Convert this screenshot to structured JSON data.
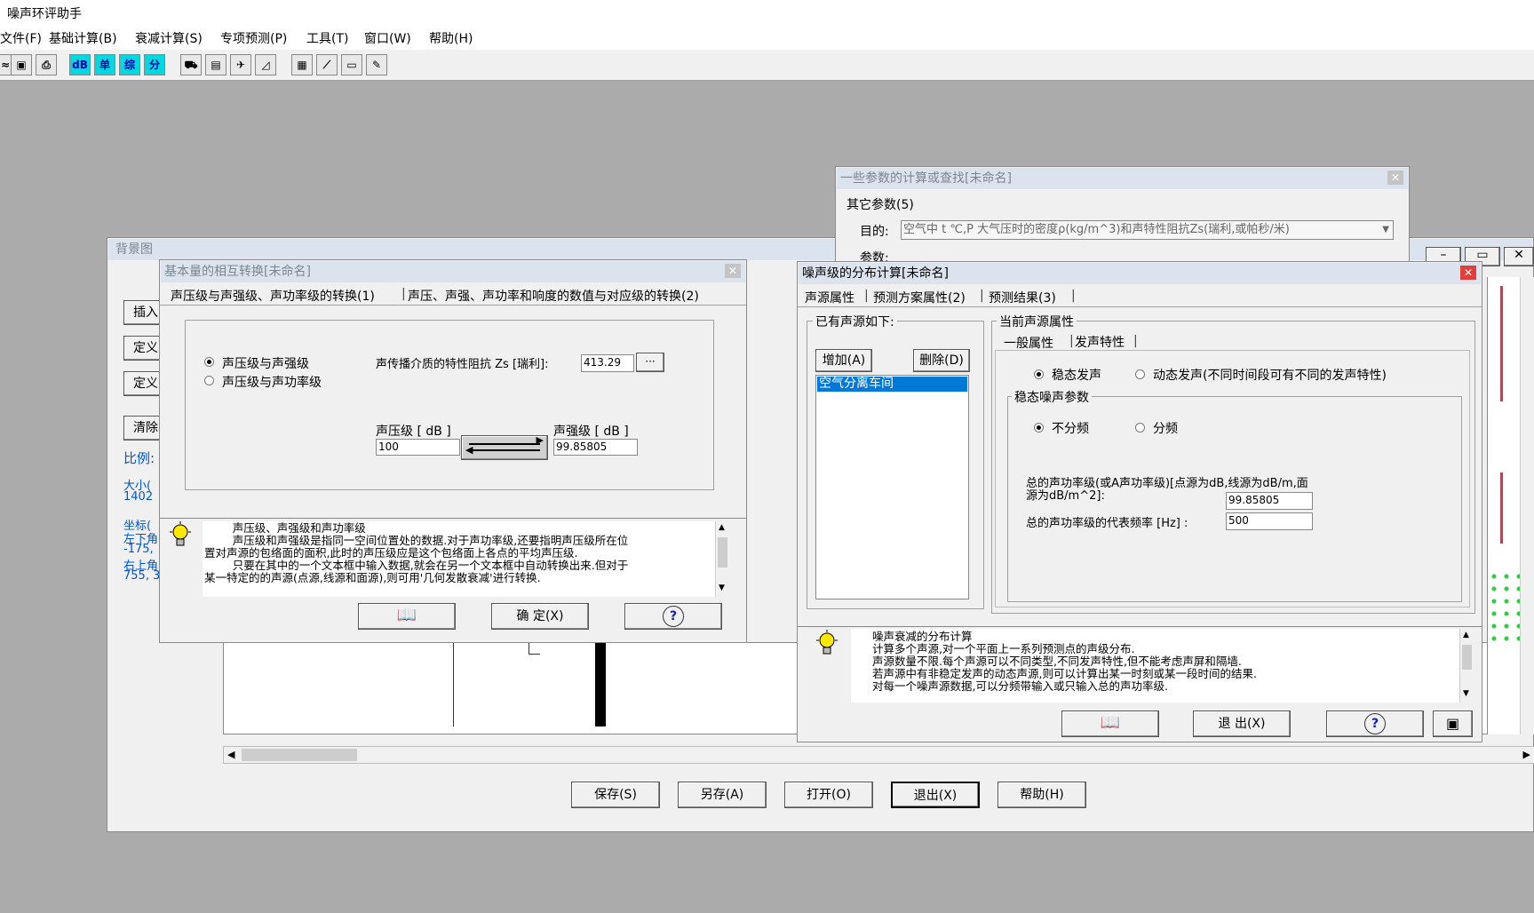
{
  "app": {
    "title": "噪声环评助手"
  },
  "menu": [
    "文件(F)",
    "基础计算(B)",
    "衰减计算(S)",
    "专项预测(P)",
    "工具(T)",
    "窗口(W)",
    "帮助(H)"
  ],
  "toolbar": {
    "icons": [
      "open-icon",
      "save-icon",
      "print-icon",
      "db-icon",
      "single-icon",
      "combined-icon",
      "split-icon",
      "road-icon",
      "train-icon",
      "plane-icon",
      "chart-icon",
      "grid-icon",
      "plot-icon",
      "calculator-icon",
      "notes-icon"
    ],
    "cyan_labels": [
      "dB",
      "单",
      "综",
      "分"
    ]
  },
  "bg_window": {
    "title": "背景图",
    "side_buttons": [
      "插入",
      "定义",
      "定义",
      "清除"
    ],
    "scale_label": "比例:",
    "size_label": "大小(",
    "size_value": "1402",
    "coord_label": "坐标(",
    "lower_left": "左下角",
    "ll_value": "-175,",
    "upper_right": "右上角",
    "ur_value": "755, 3",
    "bottom_buttons": [
      "保存(S)",
      "另存(A)",
      "打开(O)",
      "退出(X)",
      "帮助(H)"
    ]
  },
  "params_window": {
    "title": "一些参数的计算或查找[未命名]",
    "tab": "其它参数(5)",
    "purpose_label": "目的:",
    "purpose_value": "空气中 t ℃,P 大气压时的密度ρ(kg/m^3)和声特性阻抗Zs(瑞利,或帕秒/米)",
    "param_label": "参数:"
  },
  "convert_window": {
    "title": "基本量的相互转换[未命名]",
    "tabs": [
      "声压级与声强级、声功率级的转换(1)",
      "声压、声强、声功率和响度的数值与对应级的转换(2)"
    ],
    "radio1": "声压级与声强级",
    "radio2": "声压级与声功率级",
    "impedance_label": "声传播介质的特性阻抗 Zs [瑞利]:",
    "impedance_value": "413.29",
    "ellipsis": "···",
    "spl_label": "声压级 [ dB ]",
    "spl_value": "100",
    "sil_label": "声强级 [ dB ]",
    "sil_value": "99.85805",
    "help_text": "        声压级、声强级和声功率级\n        声压级和声强级是指同一空间位置处的数据.对于声功率级,还要指明声压级所在位\n置对声源的包络面的面积,此时的声压级应是这个包络面上各点的平均声压级.\n        只要在其中的一个文本框中输入数据,就会在另一个文本框中自动转换出来.但对于\n某一特定的的声源(点源,线源和面源),则可用'几何发散衰减'进行转换.",
    "ok_button": "确 定(X)",
    "help_q": "?"
  },
  "dist_window": {
    "title": "噪声级的分布计算[未命名]",
    "tabs": [
      "声源属性",
      "预测方案属性(2)",
      "预测结果(3)"
    ],
    "existing_label": "已有声源如下:",
    "add_button": "增加(A)",
    "delete_button": "删除(D)",
    "sources": [
      "空气分离车间"
    ],
    "current_label": "当前声源属性",
    "subtabs": [
      "一般属性",
      "发声特性"
    ],
    "steady_label": "稳态发声",
    "dynamic_label": "动态发声(不同时间段可有不同的发声特性)",
    "steady_params_label": "稳态噪声参数",
    "nofreq_label": "不分频",
    "freq_label": "分频",
    "total_power_label_1": "总的声功率级(或A声功率级)[点源为dB,线源为dB/m,面",
    "total_power_label_2": "源为dB/m^2]:",
    "total_power_value": "99.85805",
    "rep_freq_label": "总的声功率级的代表频率  [Hz] :",
    "rep_freq_value": "500",
    "help_text": "噪声衰减的分布计算\n计算多个声源,对一个平面上一系列预测点的声级分布.\n声源数量不限.每个声源可以不同类型,不同发声特性,但不能考虑声屏和隔墙.\n若声源中有非稳定发声的动态声源,则可以计算出某一时刻或某一段时间的结果.\n对每一个噪声源数据,可以分频带输入或只输入总的声功率级.",
    "exit_button": "退 出(X)",
    "help_q": "?"
  }
}
